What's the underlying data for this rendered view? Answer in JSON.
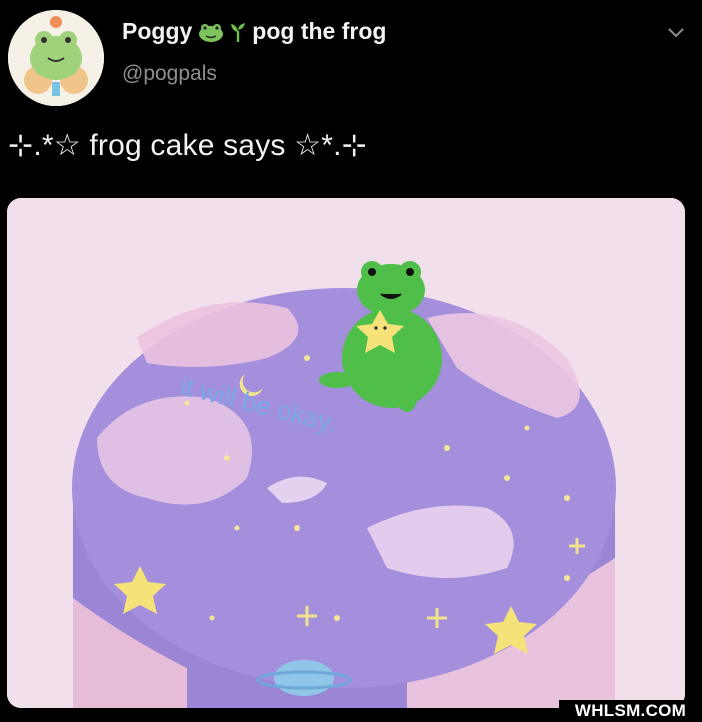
{
  "tweet": {
    "display_name": "Poggy",
    "display_name_suffix": "pog the frog",
    "handle": "@pogpals",
    "text": "⊹.*☆ frog cake says ☆*.⊹"
  },
  "image": {
    "cake_message": "it will be okay."
  },
  "watermark": "WHLSM.COM",
  "colors": {
    "background": "#000000",
    "cake_purple": "#9b86d6",
    "cake_pink": "#f0c6df",
    "frog_green": "#4fc24a",
    "star_yellow": "#f4e37a"
  }
}
